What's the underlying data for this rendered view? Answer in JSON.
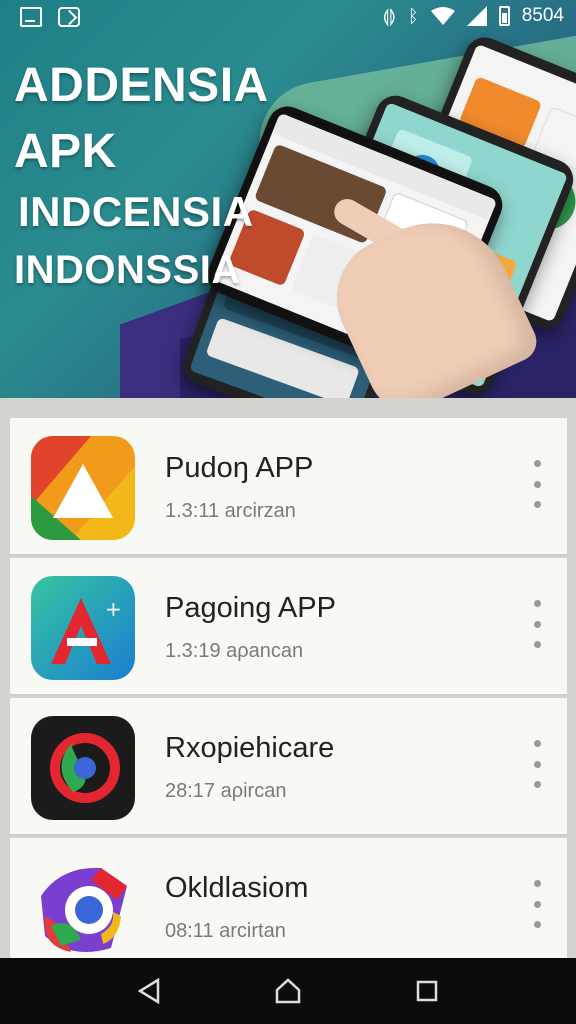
{
  "status_bar": {
    "time": "8504",
    "icons": [
      "screenshot-icon",
      "cast-icon",
      "vibrate-icon",
      "bluetooth-icon",
      "wifi-icon",
      "signal-icon",
      "battery-icon"
    ]
  },
  "hero": {
    "title_lines": [
      "ADDENSIA",
      "APK",
      "INDCENSIA",
      "INDONSSIA"
    ],
    "colors": {
      "teal": "#1e7f86",
      "purple": "#3b2e7e",
      "mint": "#70b89a"
    }
  },
  "apps": [
    {
      "name": "Pudoŋ APP",
      "meta": "1.3:11 arcirzan",
      "icon": "triangle-logo-icon"
    },
    {
      "name": "Paɡoing APP",
      "meta": "1.3:19 aρancan",
      "icon": "letter-a-logo-icon"
    },
    {
      "name": "Rxopiehicare",
      "meta": "28:17 aρircan",
      "icon": "swirl-logo-icon"
    },
    {
      "name": "Okldlasiom",
      "meta": "08:11 arcirtan",
      "icon": "camera-swirl-logo-icon"
    }
  ],
  "nav": {
    "back": "back-icon",
    "home": "home-icon",
    "recents": "recents-icon"
  }
}
